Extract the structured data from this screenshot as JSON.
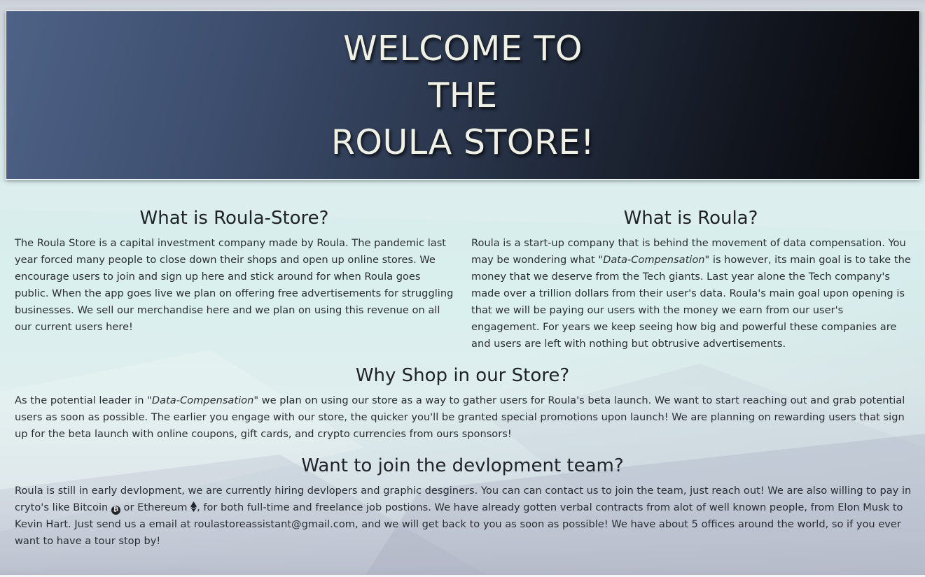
{
  "hero": {
    "title_lines": [
      "WELCOME TO",
      "THE",
      "ROULA STORE!"
    ]
  },
  "sections": {
    "roula_store": {
      "heading": "What is Roula-Store?",
      "body": "The Roula Store is a capital investment company made by Roula. The pandemic last year forced many people to close down their shops and open up online stores. We encourage users to join and sign up here and stick around for when Roula goes public. When the app goes live we plan on offering free advertisements for struggling businesses. We sell our merchandise here and we plan on using this revenue on all our current users here!"
    },
    "roula": {
      "heading": "What is Roula?",
      "body_start": "Roula is a start-up company that is behind the movement of data compensation. You may be wondering what ",
      "quoted_term": "\"Data-Compensation\"",
      "body_end": " is however, its main goal is to take the money that we deserve from the Tech giants. Last year alone the Tech company's made over a trillion dollars from their user's data. Roula's main goal upon opening is that we will be paying our users with the money we earn from our user's engagement. For years we keep seeing how big and powerful these companies are and users are left with nothing but obtrusive advertisements."
    },
    "why_shop": {
      "heading": "Why Shop in our Store?",
      "body_start": "As the potential leader in ",
      "quoted_term": "\"Data-Compensation\"",
      "body_end": " we plan on using our store as a way to gather users for Roula's beta launch. We want to start reaching out and grab potential users as soon as possible. The earlier you engage with our store, the quicker you'll be granted special promotions upon launch! We are planning on rewarding users that sign up for the beta launch with online coupons, gift cards, and crypto currencies from ours sponsors!"
    },
    "join_team": {
      "heading": "Want to join the devlopment team?",
      "body_start": "Roula is still in early devlopment, we are currently hiring devlopers and graphic desginers. You can can contact us to join the team, just reach out! We are also willing to pay in cryto's like Bitcoin ",
      "bitcoin_icon": "bitcoin-icon",
      "body_mid": " or Ethereum ",
      "ethereum_icon": "ethereum-icon",
      "body_end": ", for both full-time and freelance job postions. We have already gotten verbal contracts from alot of well known people, from Elon Musk to Kevin Hart. Just send us a email at roulastoreassistant@gmail.com, and we will get back to you as soon as possible! We have about 5 offices around the world, so if you ever want to have a tour stop by!"
    }
  },
  "colors": {
    "hero_gradient_start": "#4e6287",
    "hero_gradient_end": "#050608",
    "hero_text": "#eef1e4",
    "body_text": "#212529",
    "page_background": "#d9f0ee"
  }
}
